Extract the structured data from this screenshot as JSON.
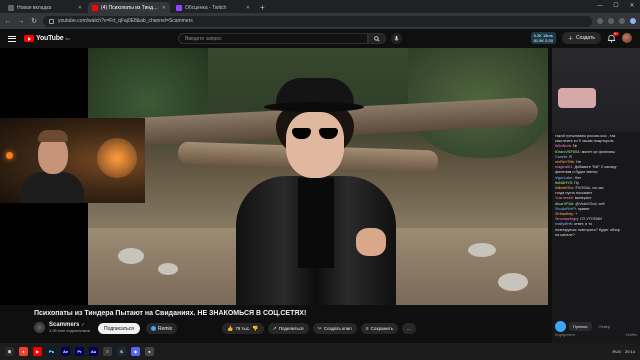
{
  "browser": {
    "tabs": [
      {
        "title": "Новая вкладка",
        "favicon_color": "#5f6368",
        "active": false
      },
      {
        "title": "(4) Психопаты из Тиндера",
        "favicon_color": "#ff0000",
        "active": true
      },
      {
        "title": "Обсценка - Twitch",
        "favicon_color": "#9146ff",
        "active": false
      }
    ],
    "url": "youtube.com/watch?v=Frt_qFaj0E8&ab_channel=Scammers"
  },
  "youtube": {
    "logo_text": "YouTube",
    "logo_sup": "RU",
    "search_placeholder": "Введите запрос",
    "stats_line1": "5.2K 15ms",
    "stats_line2": "81.9K 0.00",
    "create_label": "Создать",
    "notifications": "9+"
  },
  "video": {
    "title": "Психопаты из Тиндера Пытают на Свиданиях. НЕ ЗНАКОМЬСЯ В СОЦ.СЕТЯХ!",
    "channel_name": "Scammers",
    "subscribers": "1,95 млн подписчиков",
    "subscribe_label": "Подписаться",
    "remix_label": "Remix",
    "likes_label": "79 тыс.",
    "share_label": "Поделиться",
    "clip_label": "Создать клип",
    "save_label": "Сохранить",
    "more_label": "..."
  },
  "chat": {
    "messages": [
      {
        "user": "",
        "text": "такой трешниииы россия.ооо , так",
        "cls": ""
      },
      {
        "user": "",
        "text": "какслеите ко 9 часам пожрткусль",
        "cls": ""
      },
      {
        "user": "Wtm№vb:",
        "text": "№",
        "cls": "u1"
      },
      {
        "user": "ЮrarcVSF6S4:",
        "text": "минет це финелиы",
        "cls": "u3"
      },
      {
        "user": "Cwarbi:",
        "text": "Я",
        "cls": "u2"
      },
      {
        "user": "ninRwYRtb:",
        "text": "Не",
        "cls": "u4"
      },
      {
        "user": "magical61:",
        "text": "Добавьте \"ВИ\" Х канару",
        "cls": "u1"
      },
      {
        "user": "",
        "text": "финелим и будит минер",
        "cls": ""
      },
      {
        "user": "VigerLater:",
        "text": "Нет",
        "cls": "u2"
      },
      {
        "user": "ItsNAHYS:",
        "text": "Пу",
        "cls": "u3"
      },
      {
        "user": "iNikeleOhc:",
        "text": "FVOSAc, на час",
        "cls": "u4"
      },
      {
        "user": "",
        "text": "тогда пусть поскажет",
        "cls": ""
      },
      {
        "user": "Yusrneshk:",
        "text": "минерист",
        "cls": "u1"
      },
      {
        "user": "AlcarVF6A:",
        "text": "@VldaYOnd, хей",
        "cls": "u3"
      },
      {
        "user": "ShuAnRvrPl:",
        "text": "привет",
        "cls": "u2"
      },
      {
        "user": "SirMadhdy:",
        "text": "+",
        "cls": "u4"
      },
      {
        "user": "Sinomwrbrgnj:",
        "text": "ГО УТОПИИ",
        "cls": "u1"
      },
      {
        "user": "realtydfrrfl:",
        "text": "ответ, я то",
        "cls": "u2"
      },
      {
        "user": "",
        "text": "планируешь повторить? будит обзор",
        "cls": ""
      },
      {
        "user": "",
        "text": "на канале?",
        "cls": ""
      }
    ],
    "tab_preview": "Превью",
    "tab_other": "Отвер",
    "footer_left": "Engagement",
    "footer_right": "Onlifter"
  },
  "taskbar": {
    "apps": [
      {
        "label": "⊞",
        "color": "#2b2b2b"
      },
      {
        "label": "●",
        "color": "#ea4335"
      },
      {
        "label": "▶",
        "color": "#ff0000"
      },
      {
        "label": "Ps",
        "color": "#001e36"
      },
      {
        "label": "Ae",
        "color": "#00005b"
      },
      {
        "label": "Pr",
        "color": "#00005b"
      },
      {
        "label": "Au",
        "color": "#00005b"
      },
      {
        "label": "≡",
        "color": "#3a3a3a"
      },
      {
        "label": "S",
        "color": "#1b2838"
      },
      {
        "label": "◆",
        "color": "#5865f2"
      },
      {
        "label": "●",
        "color": "#444"
      }
    ],
    "tray_text": "RUS",
    "time": "20:14"
  }
}
